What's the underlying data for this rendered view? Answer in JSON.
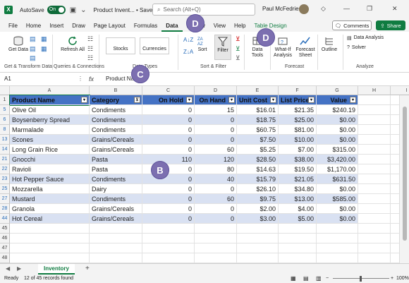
{
  "titlebar": {
    "autosave": "AutoSave",
    "toggle": "On",
    "title": "Product Invent... • Saved",
    "search_placeholder": "Search (Alt+Q)",
    "user": "Paul McFedries"
  },
  "menu": {
    "tabs": [
      "File",
      "Home",
      "Insert",
      "Draw",
      "Page Layout",
      "Formulas",
      "Data",
      "Review",
      "View",
      "Help",
      "Table Design"
    ],
    "comments": "Comments",
    "share": "Share"
  },
  "ribbon": {
    "get_data": "Get Data",
    "refresh_all": "Refresh All",
    "stocks": "Stocks",
    "currencies": "Currencies",
    "sort": "Sort",
    "filter": "Filter",
    "data_tools": "Data Tools",
    "what_if": "What-If Analysis",
    "forecast_sheet": "Forecast Sheet",
    "outline": "Outline",
    "data_analysis": "Data Analysis",
    "solver": "Solver",
    "groups": [
      "Get & Transform Data",
      "Queries & Connections",
      "Data Types",
      "Sort & Filter",
      "Forecast",
      "Analyze"
    ]
  },
  "formula": {
    "namebox": "A1",
    "fx": "fx",
    "content": "Product Name"
  },
  "columns": [
    "A",
    "B",
    "C",
    "D",
    "E",
    "F",
    "G",
    "H",
    "I"
  ],
  "table": {
    "headers": [
      "Product Name",
      "Category",
      "On Hold",
      "On Hand",
      "Unit Cost",
      "List Price",
      "Value"
    ],
    "rows": [
      {
        "row": "5",
        "cells": [
          "Olive Oil",
          "Condiments",
          "0",
          "15",
          "$16.01",
          "$21.35",
          "$240.19"
        ]
      },
      {
        "row": "6",
        "cells": [
          "Boysenberry Spread",
          "Condiments",
          "0",
          "0",
          "$18.75",
          "$25.00",
          "$0.00"
        ]
      },
      {
        "row": "8",
        "cells": [
          "Marmalade",
          "Condiments",
          "0",
          "0",
          "$60.75",
          "$81.00",
          "$0.00"
        ]
      },
      {
        "row": "13",
        "cells": [
          "Scones",
          "Grains/Cereals",
          "0",
          "0",
          "$7.50",
          "$10.00",
          "$0.00"
        ]
      },
      {
        "row": "14",
        "cells": [
          "Long Grain Rice",
          "Grains/Cereals",
          "0",
          "60",
          "$5.25",
          "$7.00",
          "$315.00"
        ]
      },
      {
        "row": "21",
        "cells": [
          "Gnocchi",
          "Pasta",
          "110",
          "120",
          "$28.50",
          "$38.00",
          "$3,420.00"
        ]
      },
      {
        "row": "22",
        "cells": [
          "Ravioli",
          "Pasta",
          "0",
          "80",
          "$14.63",
          "$19.50",
          "$1,170.00"
        ]
      },
      {
        "row": "23",
        "cells": [
          "Hot Pepper Sauce",
          "Condiments",
          "0",
          "40",
          "$15.79",
          "$21.05",
          "$631.50"
        ]
      },
      {
        "row": "25",
        "cells": [
          "Mozzarella",
          "Dairy",
          "0",
          "0",
          "$26.10",
          "$34.80",
          "$0.00"
        ]
      },
      {
        "row": "27",
        "cells": [
          "Mustard",
          "Condiments",
          "0",
          "60",
          "$9.75",
          "$13.00",
          "$585.00"
        ]
      },
      {
        "row": "28",
        "cells": [
          "Granola",
          "Grains/Cereals",
          "0",
          "0",
          "$2.00",
          "$4.00",
          "$0.00"
        ]
      },
      {
        "row": "44",
        "cells": [
          "Hot Cereal",
          "Grains/Cereals",
          "0",
          "0",
          "$3.00",
          "$5.00",
          "$0.00"
        ]
      }
    ],
    "empty_rows": [
      "45",
      "46",
      "47",
      "48"
    ]
  },
  "sheet": {
    "name": "Inventory",
    "add": "+"
  },
  "status": {
    "ready": "Ready",
    "records": "12 of 45 records found",
    "zoom": "100%"
  },
  "callouts": {
    "c": "C",
    "b": "B",
    "d1": "D",
    "d2": "D"
  },
  "colors": {
    "excel_green": "#107c41",
    "table_header": "#4472c4",
    "band": "#d9e1f2",
    "callout": "#7c6fb0"
  }
}
